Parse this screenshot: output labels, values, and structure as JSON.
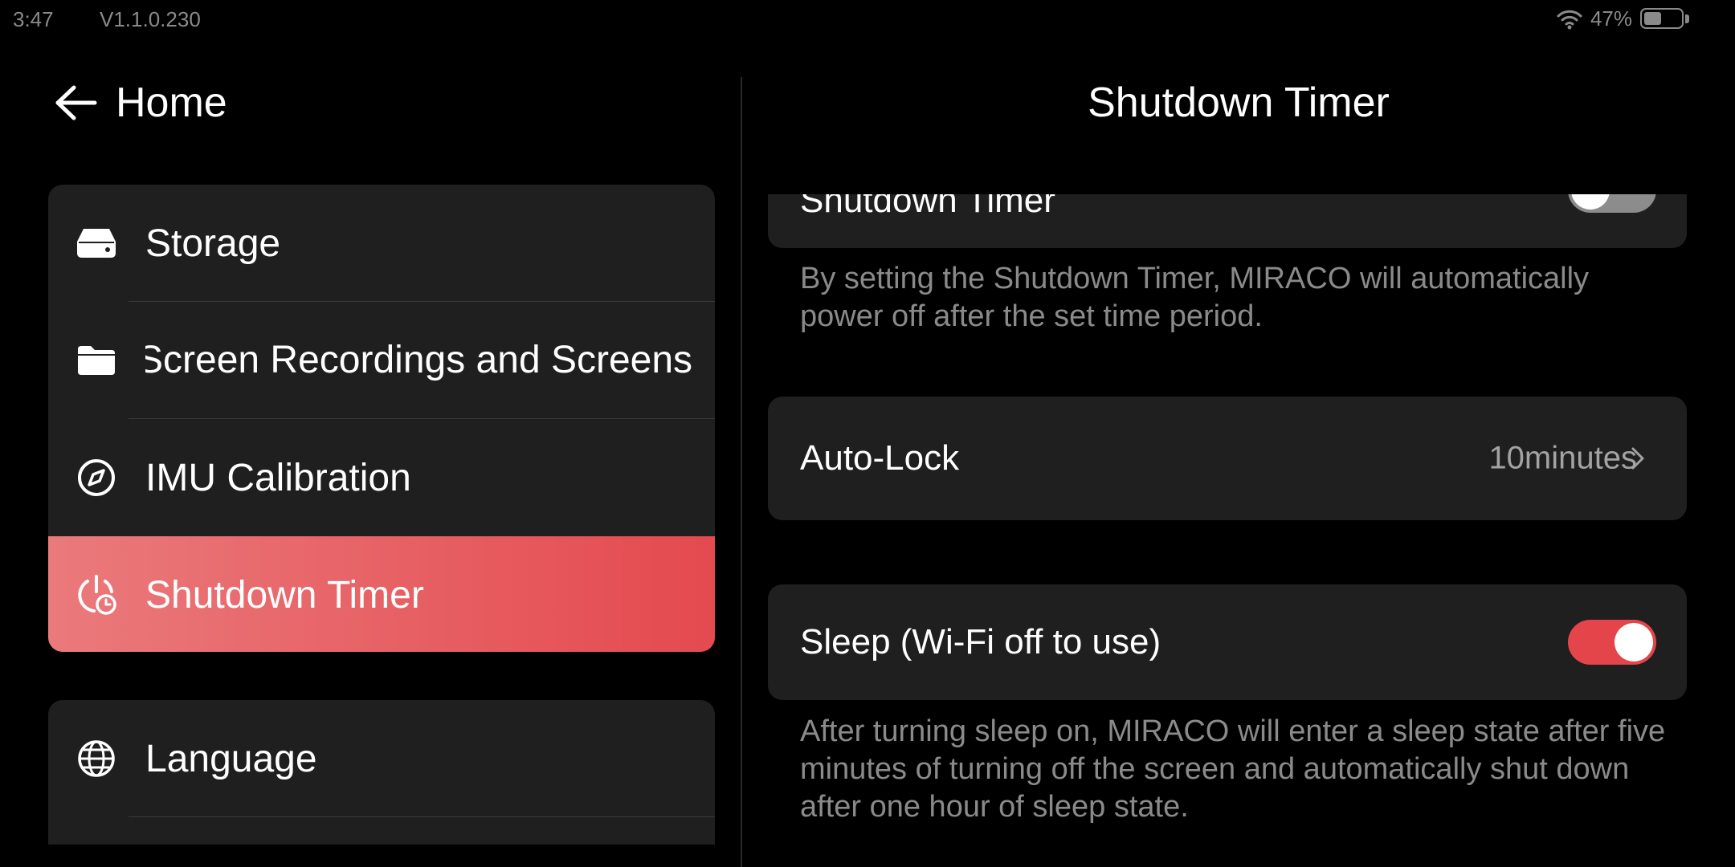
{
  "status_bar": {
    "time": "3:47",
    "version": "V1.1.0.230",
    "battery_percent": "47%",
    "battery_level": 0.47,
    "icons": [
      "wifi-icon",
      "battery-icon"
    ]
  },
  "left_pane": {
    "back_label": "Home",
    "back_icon": "back-arrow-icon",
    "groups": [
      {
        "items": [
          {
            "label": "Storage",
            "icon": "storage-icon",
            "active": false
          },
          {
            "label": "Screen Recordings and Screenshots",
            "icon": "folder-icon",
            "active": false
          },
          {
            "label": "IMU Calibration",
            "icon": "compass-icon",
            "active": false
          },
          {
            "label": "Shutdown Timer",
            "icon": "power-clock-icon",
            "active": true
          }
        ]
      },
      {
        "items": [
          {
            "label": "Language",
            "icon": "globe-icon",
            "active": false
          }
        ]
      }
    ]
  },
  "right_pane": {
    "title": "Shutdown Timer",
    "shutdown_timer": {
      "label": "Shutdown Timer",
      "enabled": false,
      "description": "By setting the Shutdown Timer, MIRACO will automatically power off after the set time period."
    },
    "auto_lock": {
      "label": "Auto-Lock",
      "value": "10minutes",
      "icon": "chevron-right-icon"
    },
    "sleep": {
      "label": "Sleep (Wi-Fi off to use)",
      "enabled": true,
      "description": "After turning sleep on, MIRACO will enter a sleep state after five minutes of turning off the screen and automatically shut down after one hour of sleep state."
    }
  },
  "colors": {
    "background": "#000000",
    "card": "#1f1f1f",
    "accent": "#e4454b",
    "accent_gradient_start": "#ea7a7c",
    "secondary_text": "#8a8a8a"
  }
}
